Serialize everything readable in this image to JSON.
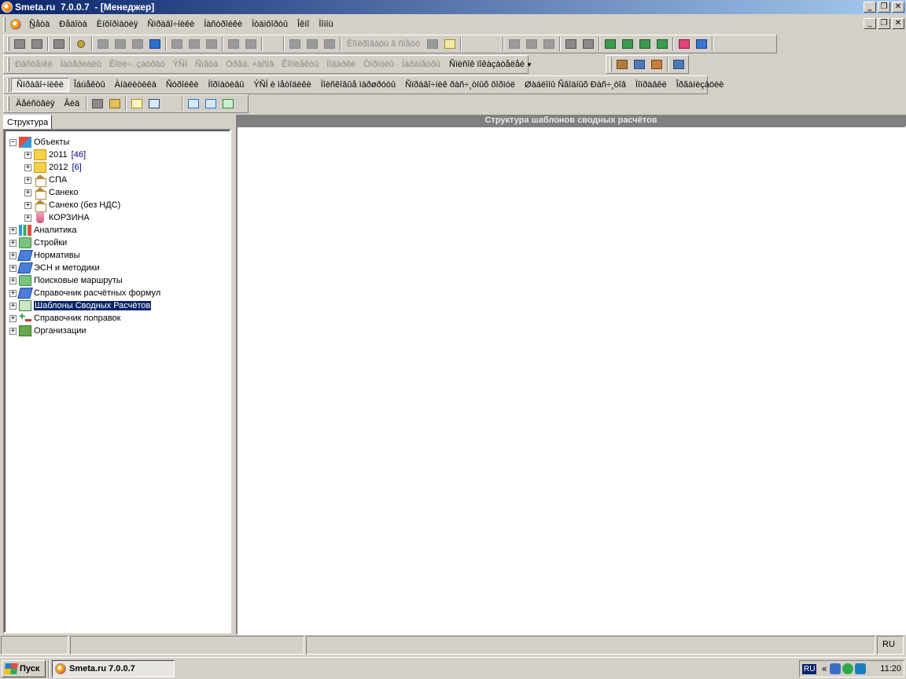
{
  "window": {
    "title": "Smeta.ru  7.0.0.7  - [Менеджер]",
    "minimize_label": "_",
    "restore_label": "❐",
    "close_label": "✕"
  },
  "menu": {
    "items": [
      "Ñ̲åòà",
      "Ðåäîòà",
      "Èíôîðìàöèÿ",
      "Ñïðàâî÷íèêè",
      "Íàñòðîéêè",
      "Ïòàìôîðòû",
      "Îêíî",
      "Ïîìîù"
    ]
  },
  "toolbar2": {
    "label": "Êîïèðîâàòü â ñìåòó"
  },
  "toolbar3": {
    "items": [
      "Ðàñöåíêè",
      "Ìàòåðèàëû",
      "Êîëè÷. çàòðàò",
      "ÝÑÍ",
      "Ñìåòà",
      "Òðåá. +àñîâ",
      "Êîìïëåêòû",
      "Ïîäàðêè",
      "Ôîðìóëû",
      "Ïàðàìåòðû"
    ],
    "dropdown_label": "Ñïèñîê ïîêàçàòåëåé"
  },
  "toolbar4": {
    "items": [
      "Ñïðàâî÷íèêè",
      "Îáúåêòû",
      "Àíàëèòèêà",
      "Ñòðîéêè",
      "Íîðìàòèâû",
      "ÝÑÍ è ìåòîäèêè",
      "Ïîèñêîâûå ìàðøðóòû",
      "Ñïðàâî÷íèê ðàñ÷¸òíûõ ôîðìóë",
      "Øàáëîíû Ñâîäíûõ Ðàñ÷¸òîâ",
      "Ïîïðàâêè",
      "Îðãàíèçàöèè"
    ],
    "active_index": 0
  },
  "toolbar5": {
    "items": [
      "Äåéñòâèÿ",
      "Âèä"
    ]
  },
  "sidebar": {
    "tab_label": "Структура"
  },
  "tree": {
    "nodes": [
      {
        "label": "Объекты",
        "count": ""
      },
      {
        "label": "2011",
        "count": "[46]"
      },
      {
        "label": "2012",
        "count": "[6]"
      },
      {
        "label": "СПА",
        "count": ""
      },
      {
        "label": "Санеко",
        "count": ""
      },
      {
        "label": "Санеко (без НДС)",
        "count": ""
      },
      {
        "label": "КОРЗИНА",
        "count": ""
      },
      {
        "label": "Аналитика",
        "count": ""
      },
      {
        "label": "Стройки",
        "count": ""
      },
      {
        "label": "Нормативы",
        "count": ""
      },
      {
        "label": "ЭСН и методики",
        "count": ""
      },
      {
        "label": "Поисковые маршруты",
        "count": ""
      },
      {
        "label": "Справочник расчётных формул",
        "count": ""
      },
      {
        "label": "Шаблоны Сводных Расчётов",
        "count": ""
      },
      {
        "label": "Справочник поправок",
        "count": ""
      },
      {
        "label": "Организации",
        "count": ""
      }
    ],
    "selected_index": 13
  },
  "main": {
    "header": "Структура шаблонов сводных расчётов"
  },
  "statusbar": {
    "language": "RU"
  },
  "taskbar": {
    "start_label": "Пуск",
    "task_label": "Smeta.ru  7.0.0.7",
    "tray_language": "RU",
    "tray_chevron": "«",
    "clock": "11:20"
  }
}
